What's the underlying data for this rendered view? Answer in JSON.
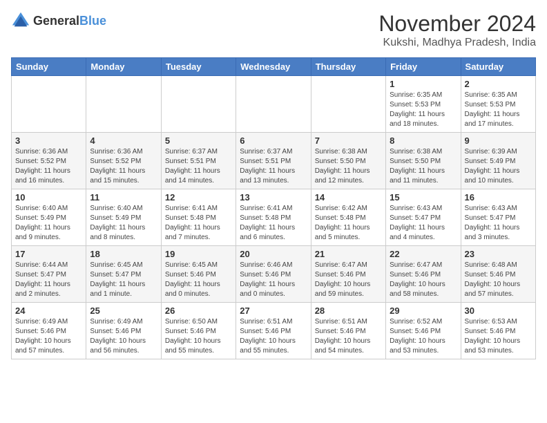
{
  "header": {
    "logo_general": "General",
    "logo_blue": "Blue",
    "month_year": "November 2024",
    "location": "Kukshi, Madhya Pradesh, India"
  },
  "weekdays": [
    "Sunday",
    "Monday",
    "Tuesday",
    "Wednesday",
    "Thursday",
    "Friday",
    "Saturday"
  ],
  "weeks": [
    [
      {
        "day": "",
        "info": ""
      },
      {
        "day": "",
        "info": ""
      },
      {
        "day": "",
        "info": ""
      },
      {
        "day": "",
        "info": ""
      },
      {
        "day": "",
        "info": ""
      },
      {
        "day": "1",
        "info": "Sunrise: 6:35 AM\nSunset: 5:53 PM\nDaylight: 11 hours and 18 minutes."
      },
      {
        "day": "2",
        "info": "Sunrise: 6:35 AM\nSunset: 5:53 PM\nDaylight: 11 hours and 17 minutes."
      }
    ],
    [
      {
        "day": "3",
        "info": "Sunrise: 6:36 AM\nSunset: 5:52 PM\nDaylight: 11 hours and 16 minutes."
      },
      {
        "day": "4",
        "info": "Sunrise: 6:36 AM\nSunset: 5:52 PM\nDaylight: 11 hours and 15 minutes."
      },
      {
        "day": "5",
        "info": "Sunrise: 6:37 AM\nSunset: 5:51 PM\nDaylight: 11 hours and 14 minutes."
      },
      {
        "day": "6",
        "info": "Sunrise: 6:37 AM\nSunset: 5:51 PM\nDaylight: 11 hours and 13 minutes."
      },
      {
        "day": "7",
        "info": "Sunrise: 6:38 AM\nSunset: 5:50 PM\nDaylight: 11 hours and 12 minutes."
      },
      {
        "day": "8",
        "info": "Sunrise: 6:38 AM\nSunset: 5:50 PM\nDaylight: 11 hours and 11 minutes."
      },
      {
        "day": "9",
        "info": "Sunrise: 6:39 AM\nSunset: 5:49 PM\nDaylight: 11 hours and 10 minutes."
      }
    ],
    [
      {
        "day": "10",
        "info": "Sunrise: 6:40 AM\nSunset: 5:49 PM\nDaylight: 11 hours and 9 minutes."
      },
      {
        "day": "11",
        "info": "Sunrise: 6:40 AM\nSunset: 5:49 PM\nDaylight: 11 hours and 8 minutes."
      },
      {
        "day": "12",
        "info": "Sunrise: 6:41 AM\nSunset: 5:48 PM\nDaylight: 11 hours and 7 minutes."
      },
      {
        "day": "13",
        "info": "Sunrise: 6:41 AM\nSunset: 5:48 PM\nDaylight: 11 hours and 6 minutes."
      },
      {
        "day": "14",
        "info": "Sunrise: 6:42 AM\nSunset: 5:48 PM\nDaylight: 11 hours and 5 minutes."
      },
      {
        "day": "15",
        "info": "Sunrise: 6:43 AM\nSunset: 5:47 PM\nDaylight: 11 hours and 4 minutes."
      },
      {
        "day": "16",
        "info": "Sunrise: 6:43 AM\nSunset: 5:47 PM\nDaylight: 11 hours and 3 minutes."
      }
    ],
    [
      {
        "day": "17",
        "info": "Sunrise: 6:44 AM\nSunset: 5:47 PM\nDaylight: 11 hours and 2 minutes."
      },
      {
        "day": "18",
        "info": "Sunrise: 6:45 AM\nSunset: 5:47 PM\nDaylight: 11 hours and 1 minute."
      },
      {
        "day": "19",
        "info": "Sunrise: 6:45 AM\nSunset: 5:46 PM\nDaylight: 11 hours and 0 minutes."
      },
      {
        "day": "20",
        "info": "Sunrise: 6:46 AM\nSunset: 5:46 PM\nDaylight: 11 hours and 0 minutes."
      },
      {
        "day": "21",
        "info": "Sunrise: 6:47 AM\nSunset: 5:46 PM\nDaylight: 10 hours and 59 minutes."
      },
      {
        "day": "22",
        "info": "Sunrise: 6:47 AM\nSunset: 5:46 PM\nDaylight: 10 hours and 58 minutes."
      },
      {
        "day": "23",
        "info": "Sunrise: 6:48 AM\nSunset: 5:46 PM\nDaylight: 10 hours and 57 minutes."
      }
    ],
    [
      {
        "day": "24",
        "info": "Sunrise: 6:49 AM\nSunset: 5:46 PM\nDaylight: 10 hours and 57 minutes."
      },
      {
        "day": "25",
        "info": "Sunrise: 6:49 AM\nSunset: 5:46 PM\nDaylight: 10 hours and 56 minutes."
      },
      {
        "day": "26",
        "info": "Sunrise: 6:50 AM\nSunset: 5:46 PM\nDaylight: 10 hours and 55 minutes."
      },
      {
        "day": "27",
        "info": "Sunrise: 6:51 AM\nSunset: 5:46 PM\nDaylight: 10 hours and 55 minutes."
      },
      {
        "day": "28",
        "info": "Sunrise: 6:51 AM\nSunset: 5:46 PM\nDaylight: 10 hours and 54 minutes."
      },
      {
        "day": "29",
        "info": "Sunrise: 6:52 AM\nSunset: 5:46 PM\nDaylight: 10 hours and 53 minutes."
      },
      {
        "day": "30",
        "info": "Sunrise: 6:53 AM\nSunset: 5:46 PM\nDaylight: 10 hours and 53 minutes."
      }
    ]
  ]
}
